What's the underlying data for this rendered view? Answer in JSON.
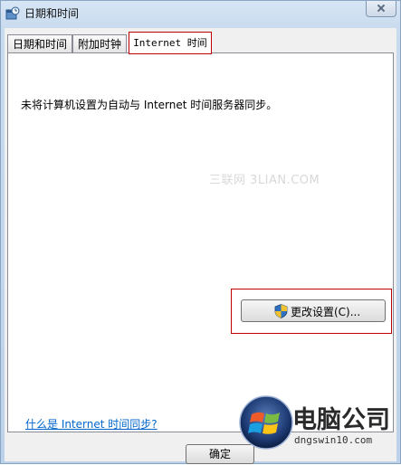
{
  "window": {
    "title": "日期和时间"
  },
  "tabs": [
    {
      "label": "日期和时间",
      "active": false
    },
    {
      "label": "附加时钟",
      "active": false
    },
    {
      "label": "Internet 时间",
      "active": true
    }
  ],
  "panel": {
    "status_text": "未将计算机设置为自动与 Internet 时间服务器同步。",
    "watermark": "三联网 3LIAN.COM",
    "change_button_label": "更改设置(C)...",
    "help_link": "什么是 Internet 时间同步?"
  },
  "footer": {
    "ok_label": "确定"
  },
  "brand": {
    "name": "电脑公司",
    "url": "dngswin10.com"
  },
  "colors": {
    "highlight": "#c00000",
    "link": "#0066cc",
    "titlebar": "#c9dbee"
  },
  "icons": {
    "title": "datetime-icon",
    "button": "uac-shield-icon",
    "brand": "windows-logo-icon"
  }
}
